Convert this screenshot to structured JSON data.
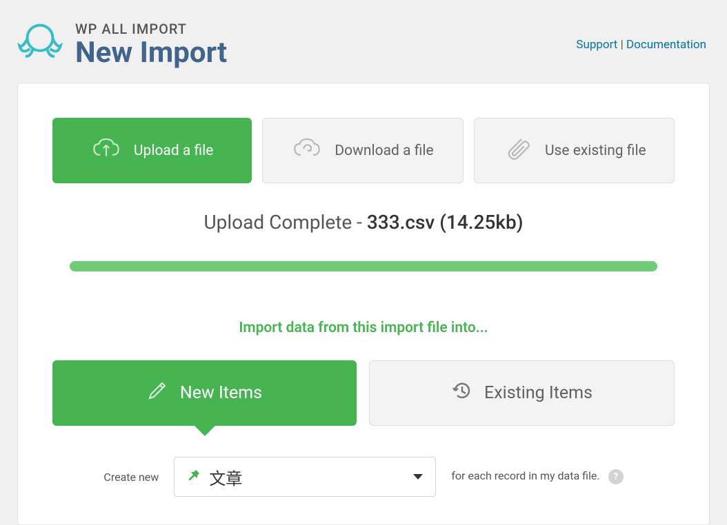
{
  "header": {
    "subtitle": "WP ALL IMPORT",
    "title": "New Import",
    "support_link": "Support",
    "docs_link": "Documentation"
  },
  "options": {
    "upload": "Upload a file",
    "download": "Download a file",
    "existing": "Use existing file"
  },
  "upload": {
    "status_label": "Upload Complete",
    "separator": " - ",
    "filename": "333.csv (14.25kb)"
  },
  "section_title": "Import data from this import file into...",
  "modes": {
    "new": "New Items",
    "existing": "Existing Items"
  },
  "create": {
    "prefix": "Create new",
    "selected": "文章",
    "suffix": "for each record in my data file."
  }
}
